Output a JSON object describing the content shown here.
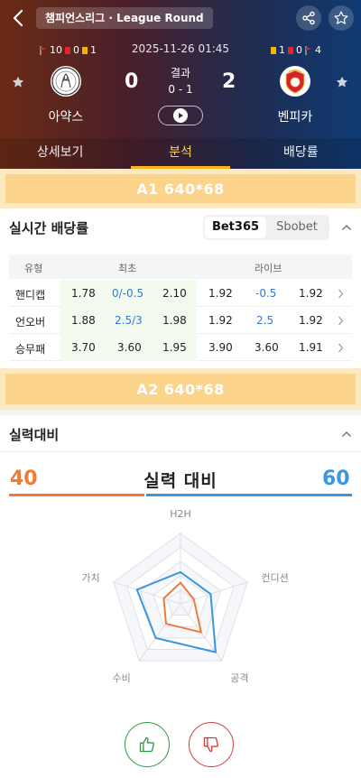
{
  "header": {
    "league": "챔피언스리그 · League Round",
    "datetime": "2025-11-26 01:45",
    "result_label": "결과",
    "ht_score": "0 - 1",
    "home": {
      "name": "아약스",
      "score": "0",
      "corners": "10",
      "red_cards": "0",
      "yellow_cards": "1"
    },
    "away": {
      "name": "벤피카",
      "score": "2",
      "yellow_cards": "1",
      "red_cards": "0",
      "corners": "4"
    },
    "colors": {
      "yellow_card": "#f5b400",
      "red_card": "#e0262c",
      "corner": "#e0262c"
    }
  },
  "tabs": [
    {
      "label": "상세보기",
      "active": false
    },
    {
      "label": "분석",
      "active": true
    },
    {
      "label": "배당률",
      "active": false
    }
  ],
  "ads": {
    "a1": "A1  640*68",
    "a2": "A2  640*68"
  },
  "odds": {
    "title": "실시간 배당률",
    "bookmakers": [
      {
        "label": "Bet365",
        "active": true
      },
      {
        "label": "Sbobet",
        "active": false
      }
    ],
    "headers": {
      "type": "유형",
      "initial": "최초",
      "live": "라이브"
    },
    "rows": [
      {
        "type": "핸디캡",
        "init": [
          "1.78",
          "0/-0.5",
          "2.10"
        ],
        "live": [
          "1.92",
          "-0.5",
          "1.92"
        ]
      },
      {
        "type": "언오버",
        "init": [
          "1.88",
          "2.5/3",
          "1.98"
        ],
        "live": [
          "1.92",
          "2.5",
          "1.92"
        ]
      },
      {
        "type": "승무패",
        "init": [
          "3.70",
          "3.60",
          "1.95"
        ],
        "live": [
          "3.90",
          "3.60",
          "1.91"
        ]
      }
    ]
  },
  "strength": {
    "section_title": "실력대비",
    "heading": "실력 대비",
    "home_value": "40",
    "away_value": "60",
    "home_share": 0.4,
    "away_share": 0.6,
    "home_color": "#f07a3a",
    "away_color": "#3a97dd",
    "axes": [
      "H2H",
      "컨디션",
      "공격",
      "수비",
      "가치"
    ],
    "home_levels": [
      0.3,
      0.2,
      0.5,
      0.35,
      0.25
    ],
    "away_levels": [
      0.45,
      0.45,
      0.85,
      0.6,
      0.65
    ]
  },
  "votes": {
    "up_icon": "thumbs-up-icon",
    "down_icon": "thumbs-down-icon"
  }
}
